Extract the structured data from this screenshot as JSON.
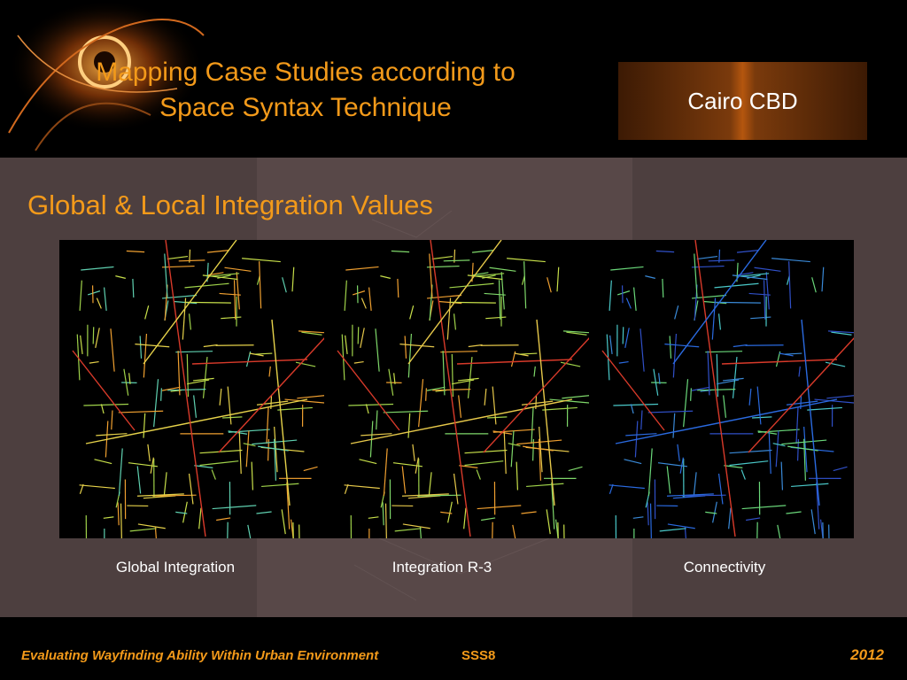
{
  "header": {
    "title_line1": "Mapping Case Studies according to",
    "title_line2": "Space Syntax Technique",
    "badge": "Cairo CBD"
  },
  "content": {
    "subtitle": "Global & Local Integration Values",
    "maps": [
      {
        "caption": "Global Integration",
        "scheme": "global"
      },
      {
        "caption": "Integration R-3",
        "scheme": "local"
      },
      {
        "caption": "Connectivity",
        "scheme": "connectivity"
      }
    ]
  },
  "footer": {
    "text": "Evaluating Wayfinding Ability Within Urban Environment",
    "code": "SSS8",
    "year": "2012"
  },
  "colors": {
    "accent": "#f39a1a",
    "panel": "#4d3f3f",
    "badge_glow": "#b4560e"
  }
}
